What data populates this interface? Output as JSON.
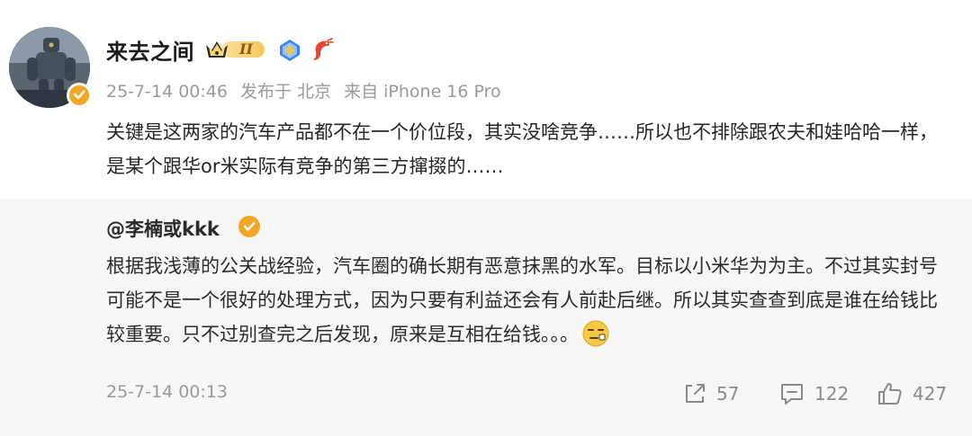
{
  "post": {
    "author": "来去之间",
    "vip_level": "II",
    "timestamp": "25-7-14 00:46",
    "posted_from_label": "发布于 北京",
    "device_label": "来自 iPhone 16 Pro",
    "text": "关键是这两家的汽车产品都不在一个价位段，其实没啥竞争……所以也不排除跟农夫和娃哈哈一样，是某个跟华or米实际有竞争的第三方撺掇的……",
    "icons": [
      "avatar",
      "verified-badge-icon",
      "vip-crown-icon",
      "medal-icon",
      "shrimp-icon"
    ],
    "colors": {
      "verified_badge": "#f5a623",
      "vip_gold": "#f7c65c",
      "medal_blue": "#3b82f6",
      "shrimp_red": "#e8452a",
      "meta_gray": "#9a9a9a",
      "repost_bg": "#f7f7f7"
    }
  },
  "repost": {
    "author": "@李楠或kkk",
    "text": "根据我浅薄的公关战经验，汽车圈的确长期有恶意抹黑的水军。目标以小米华为为主。不过其实封号可能不是一个很好的处理方式，因为只要有利益还会有人前赴后继。所以其实查查到底是谁在给钱比较重要。只不过别查完之后发现，原来是互相在给钱。。。",
    "emoji": "smirk-emoji",
    "timestamp": "25-7-14 00:13",
    "actions": {
      "share_count": "57",
      "comment_count": "122",
      "like_count": "427"
    }
  }
}
